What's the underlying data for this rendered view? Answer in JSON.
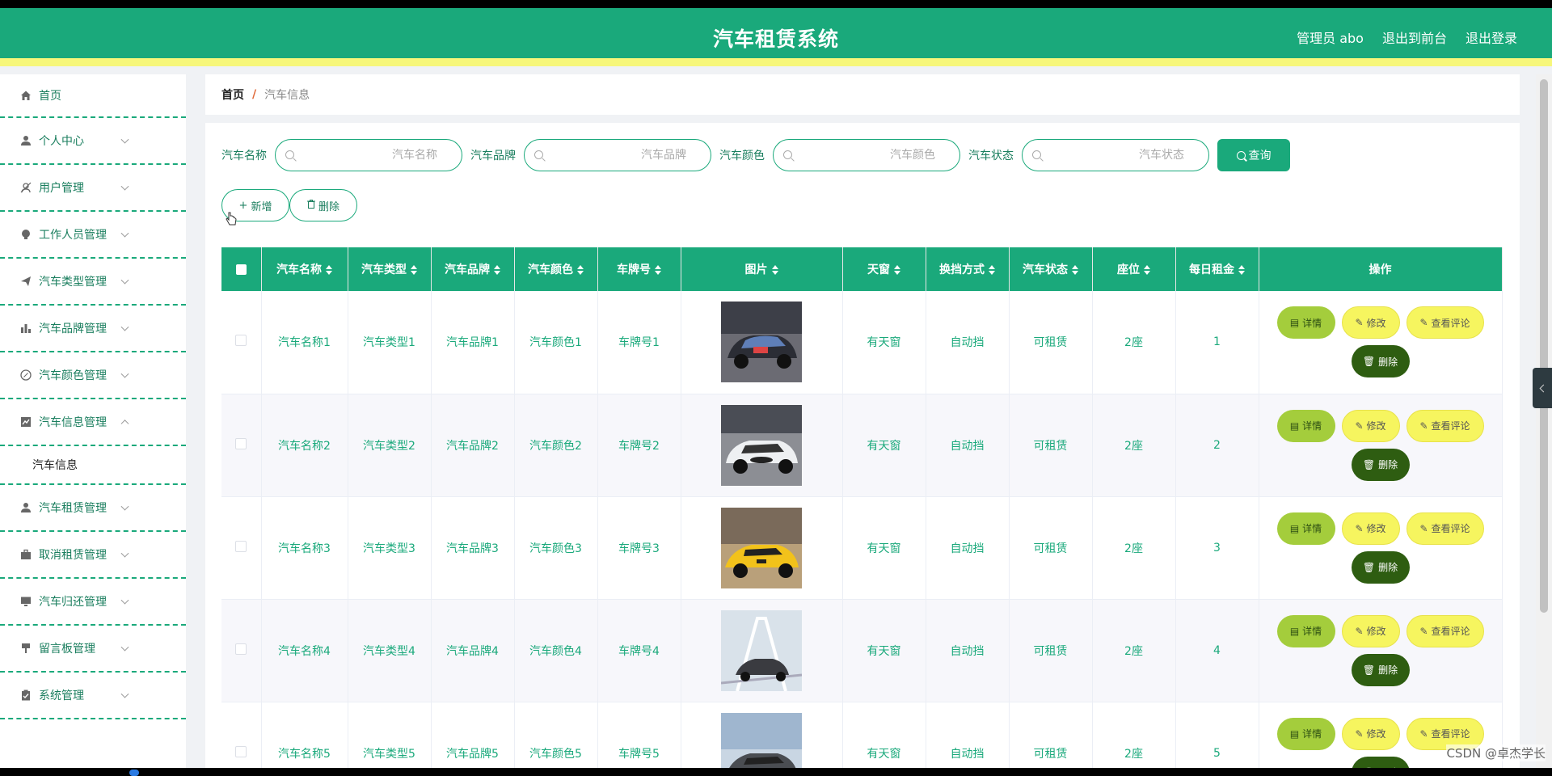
{
  "header": {
    "title": "汽车租赁系统",
    "admin": "管理员 abo",
    "to_front": "退出到前台",
    "logout": "退出登录"
  },
  "sidebar": {
    "items": [
      {
        "label": "首页",
        "icon": "home-icon"
      },
      {
        "label": "个人中心",
        "icon": "user-icon"
      },
      {
        "label": "用户管理",
        "icon": "users-icon"
      },
      {
        "label": "工作人员管理",
        "icon": "staff-icon"
      },
      {
        "label": "汽车类型管理",
        "icon": "send-icon"
      },
      {
        "label": "汽车品牌管理",
        "icon": "bar-chart-icon"
      },
      {
        "label": "汽车颜色管理",
        "icon": "compass-icon"
      },
      {
        "label": "汽车信息管理",
        "icon": "line-chart-icon"
      },
      {
        "label": "汽车租赁管理",
        "icon": "user-icon"
      },
      {
        "label": "取消租赁管理",
        "icon": "briefcase-icon"
      },
      {
        "label": "汽车归还管理",
        "icon": "monitor-icon"
      },
      {
        "label": "留言板管理",
        "icon": "pin-icon"
      },
      {
        "label": "系统管理",
        "icon": "clipboard-icon"
      }
    ],
    "sub_item": "汽车信息"
  },
  "breadcrumb": {
    "home": "首页",
    "separator": "/",
    "current": "汽车信息"
  },
  "search": {
    "fields": [
      {
        "label": "汽车名称",
        "placeholder": "汽车名称"
      },
      {
        "label": "汽车品牌",
        "placeholder": "汽车品牌"
      },
      {
        "label": "汽车颜色",
        "placeholder": "汽车颜色"
      },
      {
        "label": "汽车状态",
        "placeholder": "汽车状态"
      }
    ],
    "query_label": "查询"
  },
  "actions": {
    "add": "新增",
    "delete": "删除"
  },
  "table": {
    "columns": [
      "汽车名称",
      "汽车类型",
      "汽车品牌",
      "汽车颜色",
      "车牌号",
      "图片",
      "天窗",
      "换挡方式",
      "汽车状态",
      "座位",
      "每日租金",
      "操作"
    ],
    "rows": [
      {
        "name": "汽车名称1",
        "type": "汽车类型1",
        "brand": "汽车品牌1",
        "color": "汽车颜色1",
        "plate": "车牌号1",
        "sunroof": "有天窗",
        "gear": "自动挡",
        "status": "可租赁",
        "seats": "2座",
        "rent": "1"
      },
      {
        "name": "汽车名称2",
        "type": "汽车类型2",
        "brand": "汽车品牌2",
        "color": "汽车颜色2",
        "plate": "车牌号2",
        "sunroof": "有天窗",
        "gear": "自动挡",
        "status": "可租赁",
        "seats": "2座",
        "rent": "2"
      },
      {
        "name": "汽车名称3",
        "type": "汽车类型3",
        "brand": "汽车品牌3",
        "color": "汽车颜色3",
        "plate": "车牌号3",
        "sunroof": "有天窗",
        "gear": "自动挡",
        "status": "可租赁",
        "seats": "2座",
        "rent": "3"
      },
      {
        "name": "汽车名称4",
        "type": "汽车类型4",
        "brand": "汽车品牌4",
        "color": "汽车颜色4",
        "plate": "车牌号4",
        "sunroof": "有天窗",
        "gear": "自动挡",
        "status": "可租赁",
        "seats": "2座",
        "rent": "4"
      },
      {
        "name": "汽车名称5",
        "type": "汽车类型5",
        "brand": "汽车品牌5",
        "color": "汽车颜色5",
        "plate": "车牌号5",
        "sunroof": "有天窗",
        "gear": "自动挡",
        "status": "可租赁",
        "seats": "2座",
        "rent": "5"
      }
    ],
    "op_labels": {
      "detail": "详情",
      "edit": "修改",
      "review": "查看评论",
      "delete": "删除"
    }
  },
  "watermark": "CSDN @卓杰学长",
  "colors": {
    "primary": "#1aa97b",
    "accent_yellow": "#f7f77a",
    "detail_btn": "#a4cd3c",
    "edit_btn": "#f6f55f",
    "delete_btn": "#2e5d11"
  }
}
